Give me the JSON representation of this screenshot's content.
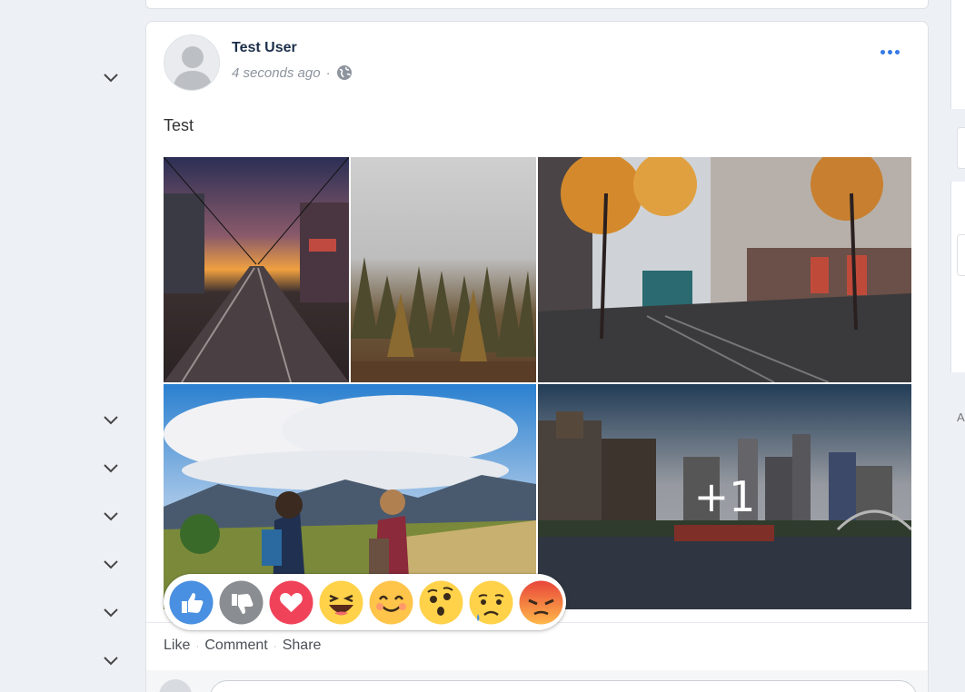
{
  "post": {
    "author": "Test User",
    "time": "4 seconds ago",
    "separator": "·",
    "text": "Test",
    "more_photos": "+1",
    "photos": [
      {
        "name": "street-sunset",
        "subject": "tram tracks street at sunset"
      },
      {
        "name": "foggy-forest",
        "subject": "foggy autumn forest"
      },
      {
        "name": "autumn-tram",
        "subject": "city tram in autumn street"
      },
      {
        "name": "mountain-hikers",
        "subject": "two hikers looking at mountains"
      },
      {
        "name": "city-river",
        "subject": "city skyline by river"
      }
    ]
  },
  "actions": {
    "like": "Like",
    "comment": "Comment",
    "share": "Share",
    "dot": "·"
  },
  "reactions": [
    "like",
    "dislike",
    "love",
    "haha",
    "yay",
    "wow",
    "sad",
    "angry"
  ],
  "right_edge_letter": "A",
  "colors": {
    "accent": "#3578e5",
    "page_bg": "#edf0f5",
    "like": "#4a90e2",
    "love": "#f0435a",
    "emoji_yellow": "#ffd24a",
    "angry_red": "#e8463a"
  }
}
